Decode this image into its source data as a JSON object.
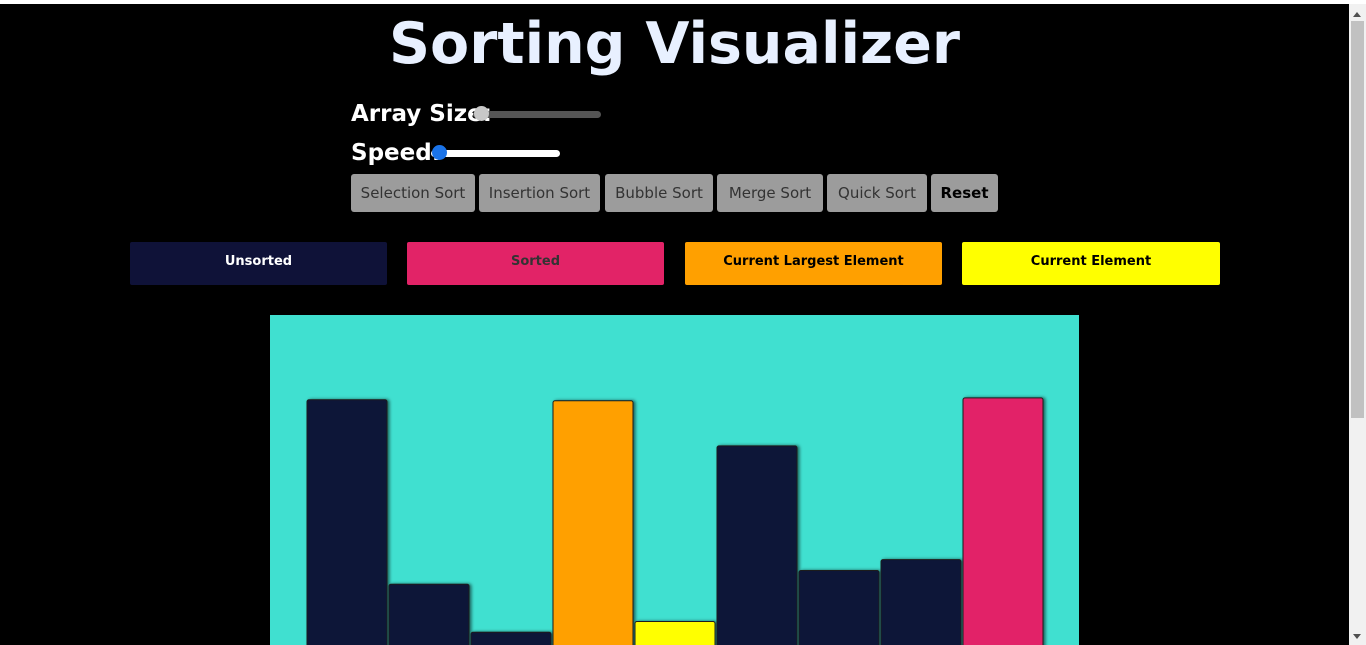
{
  "app": {
    "title": "Sorting Visualizer"
  },
  "controls": {
    "array_size_label": "Array Size:",
    "array_size_value": 0,
    "speed_label": "Speed:",
    "speed_value": 0
  },
  "buttons": [
    {
      "id": "selection",
      "label": "Selection Sort"
    },
    {
      "id": "insertion",
      "label": "Insertion Sort"
    },
    {
      "id": "bubble",
      "label": "Bubble Sort"
    },
    {
      "id": "merge",
      "label": "Merge Sort"
    },
    {
      "id": "quick",
      "label": "Quick Sort"
    },
    {
      "id": "reset",
      "label": "Reset"
    }
  ],
  "legend": [
    {
      "label": "Unsorted",
      "color": "#0f1238",
      "text_color": "#ffffff"
    },
    {
      "label": "Sorted",
      "color": "#e22367",
      "text_color": "#333333"
    },
    {
      "label": "Current Largest Element",
      "color": "#ffa000",
      "text_color": "#000000"
    },
    {
      "label": "Current Element",
      "color": "#ffff00",
      "text_color": "#000000"
    }
  ],
  "colors": {
    "background": "#000000",
    "chart_background": "#40e0d0",
    "unsorted": "#0f1238",
    "sorted": "#e22367",
    "largest": "#ffa000",
    "current": "#ffff00"
  },
  "chart_data": {
    "type": "bar",
    "values": [
      250,
      62,
      13,
      249,
      24,
      203,
      76,
      87,
      252
    ],
    "states": [
      "unsorted",
      "unsorted",
      "unsorted",
      "largest",
      "current",
      "unsorted",
      "unsorted",
      "unsorted",
      "sorted"
    ],
    "ylim": [
      0,
      260
    ]
  }
}
